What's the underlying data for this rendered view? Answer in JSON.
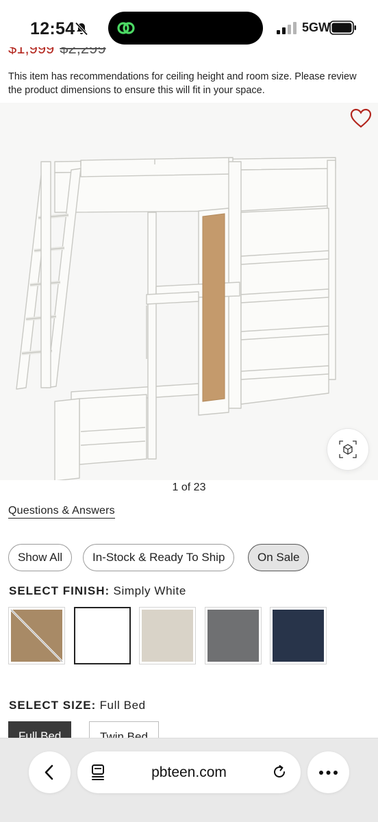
{
  "status_bar": {
    "time": "12:54",
    "network": "5GW"
  },
  "product": {
    "sale_price": "$1,999",
    "original_price": "$2,299",
    "notice": "This item has recommendations for ceiling height and room size. Please review the product dimensions to ensure this will fit in your space."
  },
  "gallery": {
    "counter": "1 of 23"
  },
  "links": {
    "questions_answers": "Questions & Answers"
  },
  "filters": [
    {
      "label": "Show All",
      "active": false
    },
    {
      "label": "In-Stock & Ready To Ship",
      "active": false
    },
    {
      "label": "On Sale",
      "active": true
    }
  ],
  "finish": {
    "heading": "SELECT FINISH:",
    "selected": "Simply White",
    "swatches": [
      {
        "color": "#a88a66",
        "unavailable": true
      },
      {
        "color": "#ffffff",
        "selected": true
      },
      {
        "color": "#d9d3c8"
      },
      {
        "color": "#6f7072"
      },
      {
        "color": "#28344a"
      }
    ]
  },
  "size": {
    "heading": "SELECT SIZE:",
    "selected": "Full Bed",
    "options": [
      "Full Bed",
      "Twin Bed"
    ]
  },
  "browser": {
    "url": "pbteen.com"
  },
  "colors": {
    "sale_red": "#b3261e",
    "heart_red": "#b3261e"
  }
}
